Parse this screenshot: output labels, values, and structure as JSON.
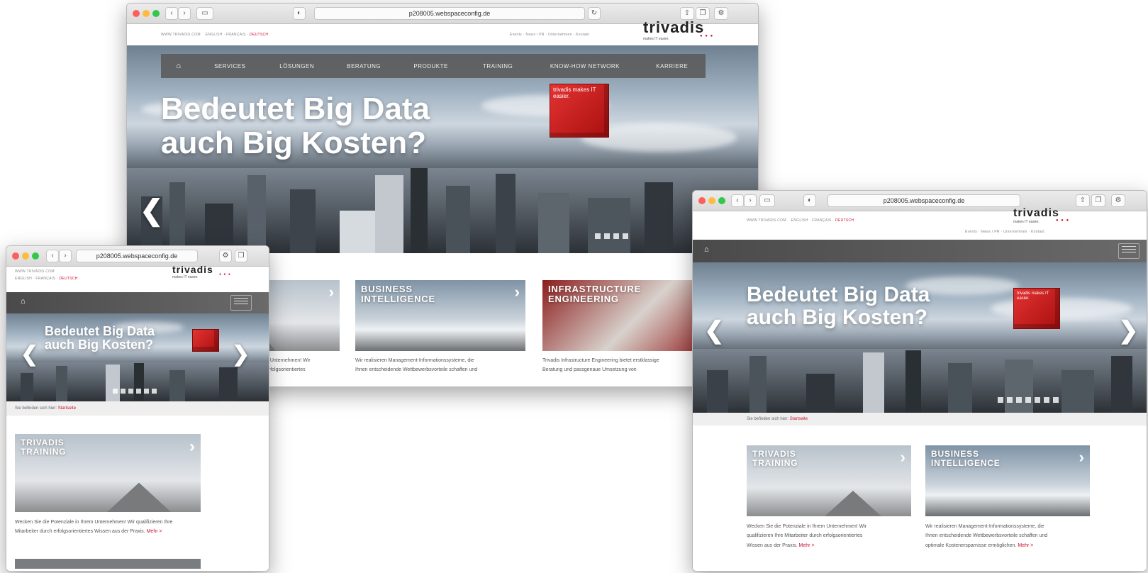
{
  "browser": {
    "url_large": "p208005.webspaceconfig.de",
    "url_medium": "p208005.webspaceconfig.de",
    "url_small": "p208005.webspaceconfig.de"
  },
  "site": {
    "top_link": "WWW.TRIVADIS.COM",
    "languages": [
      "ENGLISH",
      "FRANÇAIS",
      "DEUTSCH"
    ],
    "service_links": "Events · News / PR · Unternehmen · Kontakt",
    "logo": "trivadis",
    "logo_tagline": "makes IT easier.",
    "logo_dots": "● ● ●"
  },
  "nav": {
    "home": "⌂",
    "items": [
      "SERVICES",
      "LÖSUNGEN",
      "BERATUNG",
      "PRODUKTE",
      "TRAINING",
      "KNOW-HOW NETWORK",
      "KARRIERE"
    ]
  },
  "hero": {
    "headline_line1": "Bedeutet Big Data",
    "headline_line2": "auch Big Kosten?",
    "cube_text": "trivadis makes IT easier.",
    "prev": "❮",
    "next": "❯"
  },
  "breadcrumb": {
    "label": "Sie befinden sich hier:",
    "current": "Startseite"
  },
  "tiles": [
    {
      "title_line1": "TRIVADIS",
      "title_line2": "TRAINING",
      "text": "Wecken Sie die Potenziale in Ihrem Unternehmen! Wir qualifizieren Ihre Mitarbeiter durch erfolgsorientiertes Wissen aus der Praxis.",
      "more": "Mehr >"
    },
    {
      "title_line1": "BUSINESS",
      "title_line2": "INTELLIGENCE",
      "text": "Wir realisieren Management-Informationssysteme, die Ihnen entscheidende Wettbewerbsvorteile schaffen und optimale Kostenersparnisse ermöglichen.",
      "more": "Mehr >"
    },
    {
      "title_line1": "INFRASTRUCTURE",
      "title_line2": "ENGINEERING",
      "text": "Trivadis Infrastructure Engineering bietet erstklassige Beratung und passgenaue Umsetzung von",
      "more": ""
    }
  ],
  "partial_texts": {
    "large_tile1_line1": "n Unternehmen! Wir",
    "large_tile1_line2": "erfolgsorientiertes",
    "large_tile2_line1": "Wir realisieren Management-Informationssysteme, die",
    "large_tile2_line2": "Ihnen entscheidende Wettbewerbsvorteile schaffen und",
    "large_tile3_line1": "Trivadis Infrastructure Engineering bietet erstklassige",
    "large_tile3_line2": "Beratung und passgenaue Umsetzung von",
    "med_tile1_l1": "Wecken Sie die Potenziale in Ihrem Unternehmen! Wir",
    "med_tile1_l2": "qualifizieren Ihre Mitarbeiter durch erfolgsorientiertes",
    "med_tile1_l3": "Wissen aus der Praxis.",
    "med_tile2_l1": "Wir realisieren Management-Informationssysteme, die",
    "med_tile2_l2": "Ihnen entscheidende Wettbewerbsvorteile schaffen und",
    "med_tile2_l3": "optimale Kostenersparnisse ermöglichen.",
    "small_tile_l1": "Wecken Sie die Potenziale in Ihrem Unternehmen! Wir qualifizieren Ihre",
    "small_tile_l2": "Mitarbeiter durch erfolgsorientiertes Wissen aus der Praxis."
  },
  "colors": {
    "accent": "#c8102e",
    "nav_bg": "#5a5a5a"
  }
}
